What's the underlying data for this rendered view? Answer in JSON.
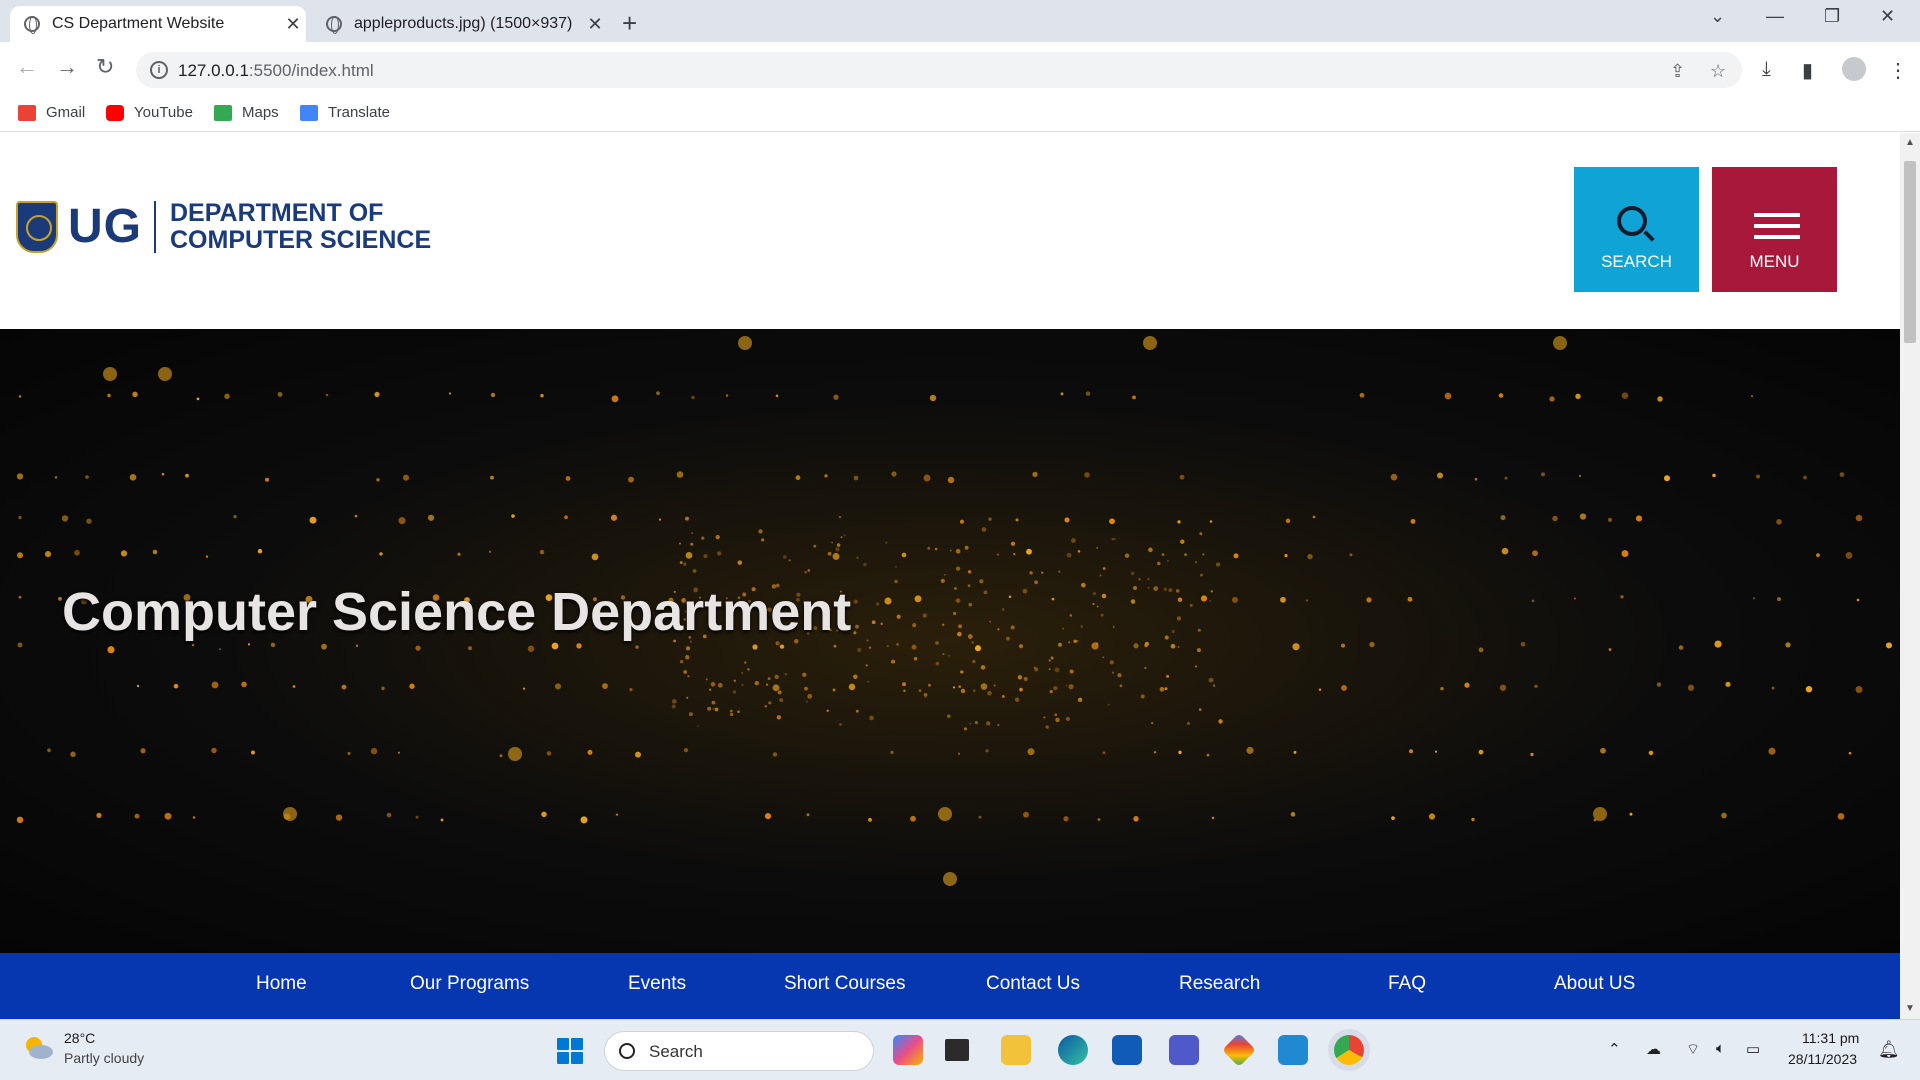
{
  "browser": {
    "tabs": [
      {
        "title": "CS Department Website",
        "active": true
      },
      {
        "title": "appleproducts.jpg) (1500×937)",
        "active": false
      }
    ],
    "new_tab": "+",
    "window_controls": {
      "list": "⌄",
      "minimize": "—",
      "restore": "❐",
      "close": "✕"
    },
    "nav": {
      "back": "←",
      "forward": "→",
      "reload": "↻"
    },
    "url": {
      "host": "127.0.0.1",
      "path": ":5500/index.html"
    },
    "bookmarks": [
      {
        "label": "Gmail",
        "icon": "gmail-icon",
        "color": "#ea4335"
      },
      {
        "label": "YouTube",
        "icon": "youtube-icon",
        "color": "#ff0000"
      },
      {
        "label": "Maps",
        "icon": "maps-icon",
        "color": "#34a853"
      },
      {
        "label": "Translate",
        "icon": "translate-icon",
        "color": "#4285f4"
      }
    ]
  },
  "site": {
    "logo_text": "UG",
    "dept_line1": "DEPARTMENT OF",
    "dept_line2": "COMPUTER SCIENCE",
    "search_label": "SEARCH",
    "menu_label": "MENU",
    "hero_title": "Computer Science Department",
    "nav": [
      "Home",
      "Our Programs",
      "Events",
      "Short Courses",
      "Contact Us",
      "Research",
      "FAQ",
      "About US"
    ],
    "colors": {
      "brand_blue": "#1b3a7a",
      "search": "#10a4d6",
      "menu": "#a8183a",
      "nav": "#0636b0"
    }
  },
  "taskbar": {
    "temperature": "28°C",
    "weather": "Partly cloudy",
    "search_placeholder": "Search",
    "time": "11:31 pm",
    "date": "28/11/2023"
  }
}
